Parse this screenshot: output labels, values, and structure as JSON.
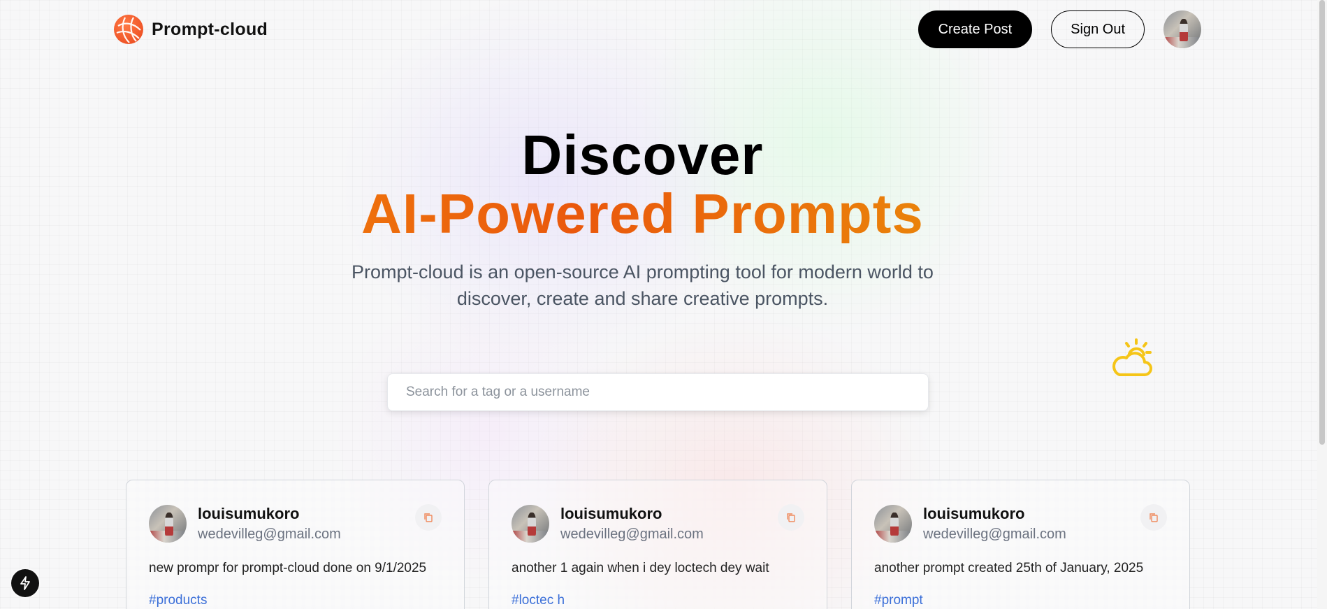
{
  "brand": {
    "name": "Prompt-cloud",
    "accent": "#ea580c"
  },
  "nav": {
    "create_label": "Create Post",
    "signout_label": "Sign Out"
  },
  "hero": {
    "title_line1": "Discover",
    "title_line2": "AI-Powered Prompts",
    "description": "Prompt-cloud is an open-source AI prompting tool for modern world to discover, create and share creative prompts."
  },
  "search": {
    "placeholder": "Search for a tag or a username",
    "value": ""
  },
  "icons": {
    "weather": "partly-cloudy-sun-icon",
    "copy": "copy-icon",
    "dev": "lightning-icon"
  },
  "cards": [
    {
      "username": "louisumukoro",
      "email": "wedevilleg@gmail.com",
      "prompt": "new prompr for prompt-cloud done on 9/1/2025",
      "tag": "#products"
    },
    {
      "username": "louisumukoro",
      "email": "wedevilleg@gmail.com",
      "prompt": "another 1 again when i dey loctech dey wait",
      "tag": "#loctec h"
    },
    {
      "username": "louisumukoro",
      "email": "wedevilleg@gmail.com",
      "prompt": "another prompt created 25th of January, 2025",
      "tag": "#prompt"
    }
  ]
}
